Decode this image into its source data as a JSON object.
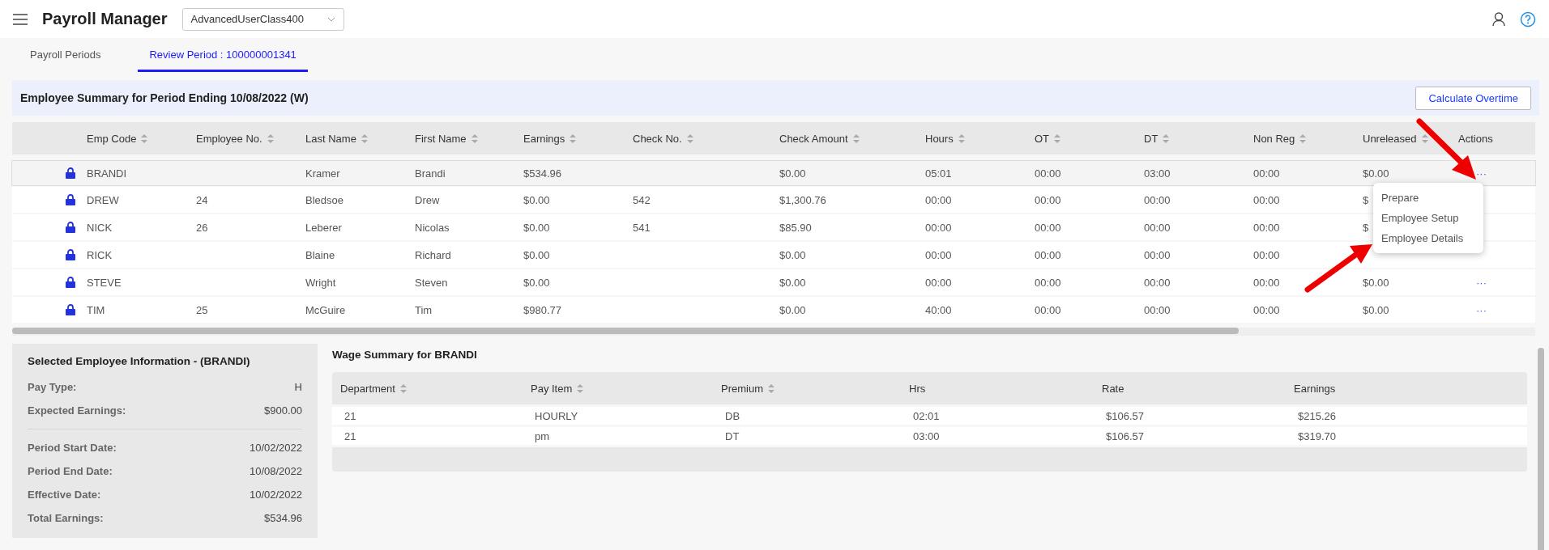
{
  "app": {
    "title": "Payroll Manager",
    "profile_select": {
      "value": "AdvancedUserClass400"
    }
  },
  "tabs": [
    {
      "label": "Payroll Periods",
      "selected": false
    },
    {
      "label": "Review Period : 100000001341",
      "selected": true
    }
  ],
  "summary": {
    "title": "Employee Summary for Period Ending 10/08/2022 (W)",
    "button": "Calculate Overtime"
  },
  "table": {
    "columns": [
      {
        "label": "Emp Code",
        "sortable": true
      },
      {
        "label": "Employee No.",
        "sortable": true
      },
      {
        "label": "Last Name",
        "sortable": true
      },
      {
        "label": "First Name",
        "sortable": true
      },
      {
        "label": "Earnings",
        "sortable": true
      },
      {
        "label": "Check No.",
        "sortable": true
      },
      {
        "label": "Check Amount",
        "sortable": true
      },
      {
        "label": "Hours",
        "sortable": true
      },
      {
        "label": "OT",
        "sortable": true
      },
      {
        "label": "DT",
        "sortable": true
      },
      {
        "label": "Non Reg",
        "sortable": true
      },
      {
        "label": "Unreleased",
        "sortable": true
      },
      {
        "label": "Actions",
        "sortable": false
      }
    ],
    "rows": [
      {
        "selected": true,
        "locked": true,
        "cells": [
          "BRANDI",
          null,
          "Kramer",
          "Brandi",
          "$534.96",
          null,
          "$0.00",
          "05:01",
          "00:00",
          "03:00",
          "00:00",
          "$0.00"
        ],
        "actions": "···"
      },
      {
        "selected": false,
        "locked": true,
        "cells": [
          "DREW",
          "24",
          "Bledsoe",
          "Drew",
          "$0.00",
          "542",
          "$1,300.76",
          "00:00",
          "00:00",
          "00:00",
          "00:00",
          "$"
        ],
        "actions": null
      },
      {
        "selected": false,
        "locked": true,
        "cells": [
          "NICK",
          "26",
          "Leberer",
          "Nicolas",
          "$0.00",
          "541",
          "$85.90",
          "00:00",
          "00:00",
          "00:00",
          "00:00",
          "$"
        ],
        "actions": null
      },
      {
        "selected": false,
        "locked": true,
        "cells": [
          "RICK",
          null,
          "Blaine",
          "Richard",
          "$0.00",
          null,
          "$0.00",
          "00:00",
          "00:00",
          "00:00",
          "00:00",
          null
        ],
        "actions": null
      },
      {
        "selected": false,
        "locked": true,
        "cells": [
          "STEVE",
          null,
          "Wright",
          "Steven",
          "$0.00",
          null,
          "$0.00",
          "00:00",
          "00:00",
          "00:00",
          "00:00",
          "$0.00"
        ],
        "actions": "···"
      },
      {
        "selected": false,
        "locked": true,
        "cells": [
          "TIM",
          "25",
          "McGuire",
          "Tim",
          "$980.77",
          null,
          "$0.00",
          "40:00",
          "00:00",
          "00:00",
          "00:00",
          "$0.00"
        ],
        "actions": "···"
      }
    ]
  },
  "action_menu": {
    "items": [
      "Prepare",
      "Employee Setup",
      "Employee Details"
    ]
  },
  "employee_info": {
    "title": "Selected Employee Information - (BRANDI)",
    "groups": [
      [
        {
          "label": "Pay Type:",
          "value": "H"
        },
        {
          "label": "Expected Earnings:",
          "value": "$900.00"
        }
      ],
      [
        {
          "label": "Period Start Date:",
          "value": "10/02/2022"
        },
        {
          "label": "Period End Date:",
          "value": "10/08/2022"
        },
        {
          "label": "Effective Date:",
          "value": "10/02/2022"
        },
        {
          "label": "Total Earnings:",
          "value": "$534.96"
        }
      ]
    ]
  },
  "wage_summary": {
    "title": "Wage Summary for BRANDI",
    "columns": [
      {
        "label": "Department",
        "sortable": true
      },
      {
        "label": "Pay Item",
        "sortable": true
      },
      {
        "label": "Premium",
        "sortable": true
      },
      {
        "label": "Hrs",
        "sortable": false
      },
      {
        "label": "Rate",
        "sortable": false
      },
      {
        "label": "Earnings",
        "sortable": false
      }
    ],
    "rows": [
      [
        "21",
        "HOURLY",
        "DB",
        "02:01",
        "$106.57",
        "$215.26"
      ],
      [
        "21",
        "pm",
        "DT",
        "03:00",
        "$106.57",
        "$319.70"
      ]
    ]
  }
}
